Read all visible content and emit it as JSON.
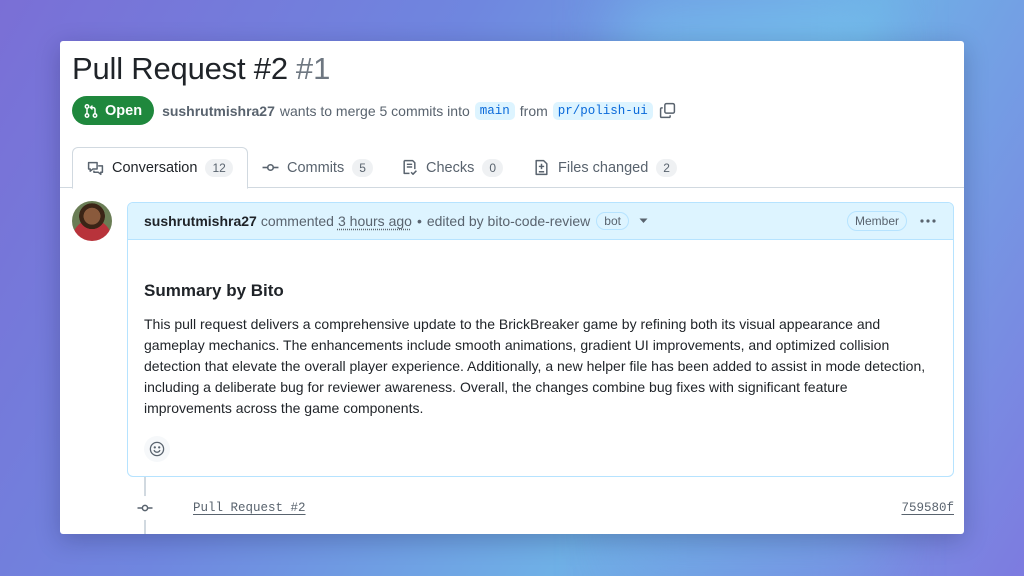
{
  "pull_request": {
    "title": "Pull Request #2",
    "number": "#1",
    "state": "Open",
    "author": "sushrutmishra27",
    "merge_text_prefix": "wants to merge 5 commits into",
    "base_branch": "main",
    "from_text": "from",
    "head_branch": "pr/polish-ui"
  },
  "tabs": [
    {
      "label": "Conversation",
      "count": "12",
      "icon": "comment-discussion-icon"
    },
    {
      "label": "Commits",
      "count": "5",
      "icon": "git-commit-icon"
    },
    {
      "label": "Checks",
      "count": "0",
      "icon": "checklist-icon"
    },
    {
      "label": "Files changed",
      "count": "2",
      "icon": "file-diff-icon"
    }
  ],
  "comment": {
    "author": "sushrutmishra27",
    "action": "commented",
    "time": "3 hours ago",
    "separator": "•",
    "edited_by": "edited by bito-code-review",
    "bot_label": "bot",
    "role_label": "Member",
    "summary_title": "Summary by Bito",
    "summary_text": "This pull request delivers a comprehensive update to the BrickBreaker game by refining both its visual appearance and gameplay mechanics. The enhancements include smooth animations, gradient UI improvements, and optimized collision detection that elevate the overall player experience. Additionally, a new helper file has been added to assist in mode detection, including a deliberate bug for reviewer awareness. Overall, the changes combine bug fixes with significant feature improvements across the game components."
  },
  "timeline": {
    "commit_title": "Pull Request #2",
    "commit_sha": "759580f"
  },
  "colors": {
    "open_badge": "#1f883d",
    "branch_text": "#0969da",
    "branch_bg": "#ddf4ff",
    "comment_header_bg": "#ddf4ff"
  }
}
